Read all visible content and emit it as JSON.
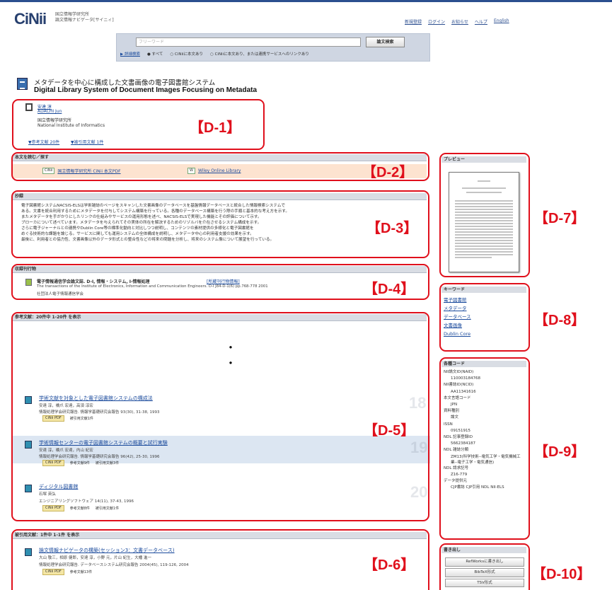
{
  "header": {
    "logo": "CiNii",
    "logo_sub": [
      "国立情報学研究所",
      "論文情報ナビゲータ[サイニィ]"
    ],
    "nav": [
      "新規登録",
      "ログイン",
      "お知らせ",
      "ヘルプ",
      "English"
    ]
  },
  "search": {
    "placeholder": "フリーワード",
    "button": "論文検索",
    "advanced": "▶ 詳細検索",
    "options": [
      "● すべて",
      "○ CiNiiに本文あり",
      "○ CiNiiに本文あり、または連携サービスへのリンクあり"
    ]
  },
  "article": {
    "title_jp": "メタデータを中心に構成した文書画像の電子図書館システム",
    "title_en": "Digital Library System of Document Images Focusing on Metadata"
  },
  "author": {
    "name_jp": "安達 淳",
    "name_en": "ADACHI Jun",
    "affil_jp": "国立情報学研究所",
    "affil_en": "National Institute of Informatics",
    "cites": [
      "▼参考文献 20件",
      "▼被引用文献 1件"
    ]
  },
  "sections": {
    "oa": "本文を読む／探す",
    "abstract": "抄録",
    "journal": "収録刊行物",
    "refs": "参考文献：20件中 1-20件 を表示",
    "cited": "被引用文献：1件中 1-1件 を表示",
    "preview": "プレビュー",
    "keywords": "キーワード",
    "codes": "各種コード",
    "export": "書き出し"
  },
  "oa_links": {
    "cinii": "国立情報学研究所 CiNii 本文PDF",
    "wiley": "Wiley Online Library"
  },
  "abstract_lines": [
    "電子図書館システムNACSIS-ELSは学術雑誌のページをスキャンした文書画像のデータベースを基盤情報データベースと統合した情報検索システムで",
    "ある。文書を統合利用するためにメタデータを付与してシステム構築を行っている。各種のデータベース構築を行う際の手順と基本的な考え方を示す。",
    "またメタデータを手がかりにしたリンクの仕組みやサービスの運用形態を述べ、NACSIS-ELSで実現した機能とその評価について示す。",
    "ブローカについて述べています。メタデータを与えられてその実体の所在を解決するためのリゾルバを介在させるシステム構成を示す。",
    "さらに電子ジャーナルとの連携やDublin Core等の標準化動向と対比しつつ説明し、コンテンツの素材提供の多様化と電子図書館を",
    "めぐる技術的な課題を論じる。サービスに関しても運用システムの全体構成を説明し、メタデータ中心の利用者支援の効果を示す。",
    "最後に、利用者との協力性、文書画像以外のデータ形式との整合性などの将来の問題を分析し、将来のシステム像について展望を行っている。"
  ],
  "journal": {
    "title": "電子情報通信学会論文誌. D-I, 情報・システム, I-情報処理",
    "link": "[所蔵刊行物情報]",
    "detail": "The transactions of the Institute of Electronics, Information and Communication Engineers. D-I  J84-D-1(6)  pp.768-778  2001",
    "publisher": "社団法人電子情報通信学会"
  },
  "references": [
    {
      "title": "学術文献を対象とした電子図書館システムの構成法",
      "meta1": "安達 淳，橋爪 宏達，高須 淳宏",
      "meta2": "情報処理学会研究報告. 情報学基礎研究会報告  93(30), 31-38, 1993",
      "tags": [
        "CiNii PDF",
        "被引用文献1件"
      ],
      "num": "18"
    },
    {
      "title": "学術情報センターの電子図書館システムの概要と試行実験",
      "meta1": "安達 淳，橋爪 宏達，内山 紀宏",
      "meta2": "情報処理学会研究報告. 情報学基礎研究会報告  96(42), 25-30, 1996",
      "tags": [
        "CiNii PDF",
        "参考文献9件",
        "被引用文献3件"
      ],
      "num": "19"
    },
    {
      "title": "ディジタル図書館",
      "meta1": "石塚 英弘",
      "meta2": "エンジニアリングソフトウェア  14(11), 37-43, 1996",
      "tags": [
        "CiNii PDF",
        "参考文献8件",
        "被引用文献1件"
      ],
      "num": "20"
    }
  ],
  "cited": {
    "title": "論文情報ナビゲータの構築(セッション3：文書データベース)",
    "meta1": "大山 敬三，相原 健郎，安達 淳，小野 元，片山 紀生，大幡 進一",
    "meta2": "情報処理学会研究報告. データベースシステム研究会報告  2004(45), 119-126, 2004",
    "tags": [
      "CiNii PDF",
      "参考文献13件"
    ]
  },
  "keywords": [
    "電子図書館",
    "メタデータ",
    "データベース",
    "文書画像",
    "Dublin Core"
  ],
  "codes": [
    [
      "NII論文ID(NAID)",
      "110003184768"
    ],
    [
      "NII書誌ID(NCID)",
      "AA11341616"
    ],
    [
      "本文言語コード",
      "JPN"
    ],
    [
      "資料種別",
      "論文"
    ],
    [
      "ISSN",
      "09151915"
    ],
    [
      "NDL 記事登録ID",
      "5662384187"
    ],
    [
      "NDL 雑誌分類",
      "ZM13(科学技術--電気工学・電気機械工業--電子工学・電気通信)"
    ],
    [
      "NDL 請求記号",
      "Z16-779"
    ],
    [
      "データ提供元",
      "CJP書誌  CJP引用  NDL  NII-ELS"
    ]
  ],
  "export": [
    "RefWorksに書き出し",
    "BibTeX形式",
    "TSV形式"
  ],
  "annotations": [
    "【D-1】",
    "【D-2】",
    "【D-3】",
    "【D-4】",
    "【D-5】",
    "【D-6】",
    "【D-7】",
    "【D-8】",
    "【D-9】",
    "【D-10】"
  ],
  "dots": [
    "・",
    "・"
  ],
  "colors": {
    "annotation": "#e0101c",
    "link": "#1a4a9c",
    "oa_band": "#fde3d0",
    "ref_band": "#dce6f2"
  }
}
